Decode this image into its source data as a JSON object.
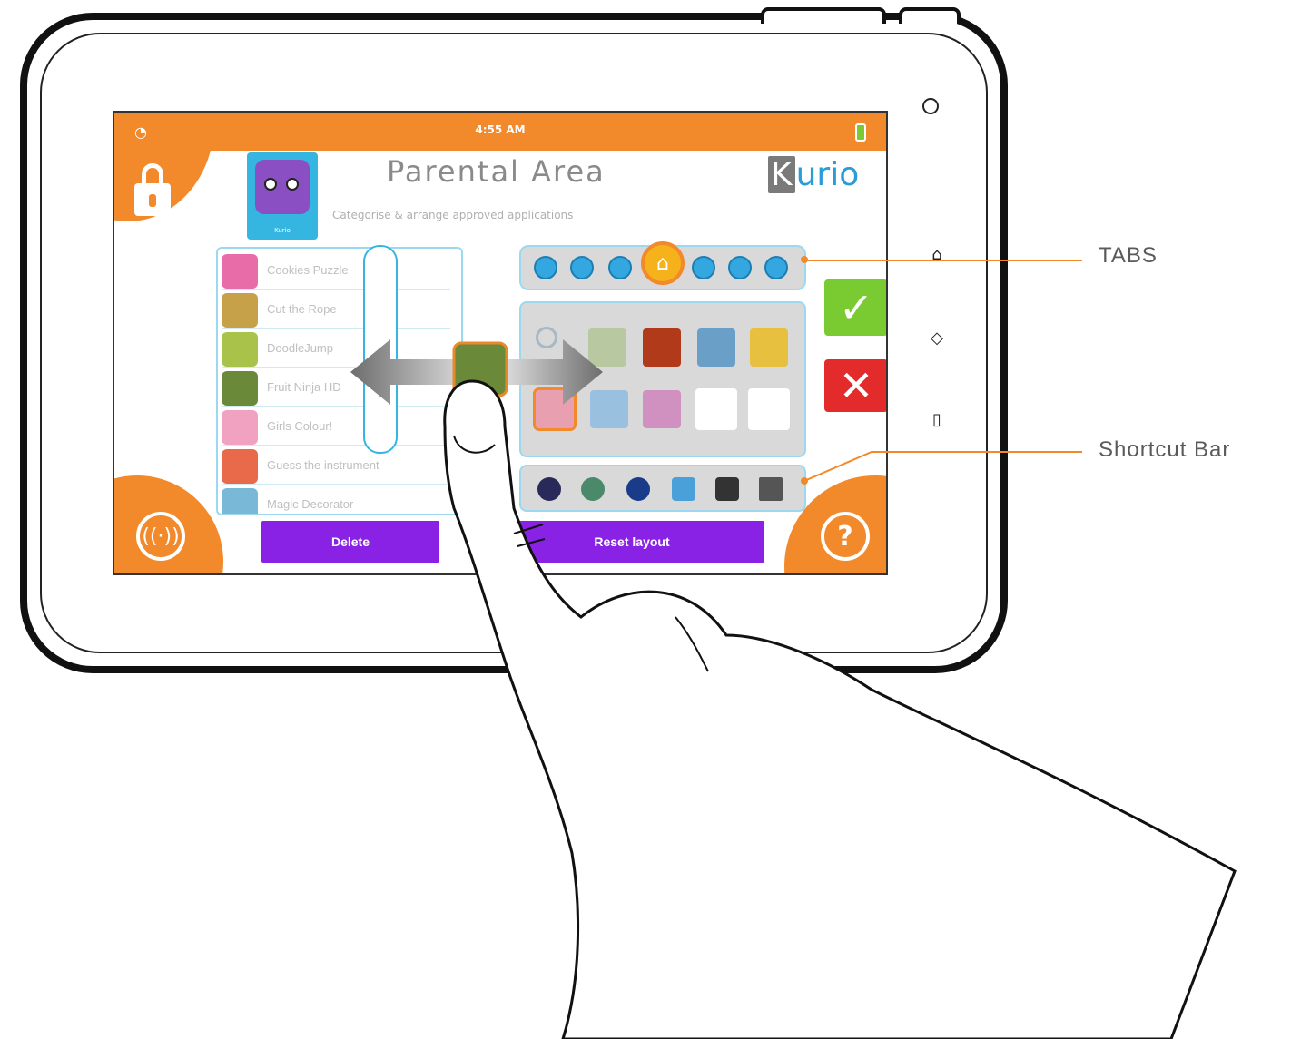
{
  "screen": {
    "status_time": "4:55 AM",
    "title": "Parental Area",
    "subtitle": "Categorise & arrange approved applications",
    "brand_k": "K",
    "brand_rest": "urio",
    "avatar_name": "Kurio"
  },
  "app_list": {
    "items": [
      {
        "label": "Cookies Puzzle",
        "icon": "cookies-puzzle-icon",
        "color": "#e86ca8"
      },
      {
        "label": "Cut the Rope",
        "icon": "cut-the-rope-icon",
        "color": "#c7a14a"
      },
      {
        "label": "DoodleJump",
        "icon": "doodle-jump-icon",
        "color": "#a8c24a"
      },
      {
        "label": "Fruit Ninja HD",
        "icon": "fruit-ninja-icon",
        "color": "#6a8a3a"
      },
      {
        "label": "Girls Colour!",
        "icon": "girls-colour-icon",
        "color": "#f0a2c0"
      },
      {
        "label": "Guess the instrument",
        "icon": "guess-instrument-icon",
        "color": "#e86a4a"
      },
      {
        "label": "Magic Decorator",
        "icon": "magic-decorator-icon",
        "color": "#7ab8d8"
      }
    ]
  },
  "buttons": {
    "delete": "Delete",
    "reset_layout": "Reset layout",
    "confirm_symbol": "✓",
    "cancel_symbol": "✕",
    "help_symbol": "?"
  },
  "callouts": {
    "tabs": "TABS",
    "shortcut_bar": "Shortcut Bar"
  },
  "colors": {
    "accent_orange": "#f2892a",
    "purple_button": "#8a22e6",
    "confirm_green": "#7acb32",
    "cancel_red": "#e32b2b",
    "border_blue": "#9cd9f0"
  }
}
